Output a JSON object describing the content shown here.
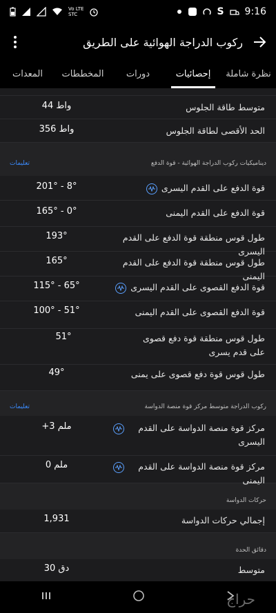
{
  "status": {
    "time": "9:16",
    "network": "STC",
    "net_type": "Vo LTE"
  },
  "appbar": {
    "title": "ركوب الدراجة الهوائية على الطريق"
  },
  "tabs": [
    {
      "label": "نظرة شاملة"
    },
    {
      "label": "إحصائيات"
    },
    {
      "label": "دورات"
    },
    {
      "label": "المخططات"
    },
    {
      "label": "المعدات"
    }
  ],
  "rows_top": [
    {
      "label": "متوسط طاقة الجلوس",
      "value": "44 واط"
    },
    {
      "label": "الحد الأقصى لطاقة الجلوس",
      "value": "356 واط"
    }
  ],
  "section_power": {
    "title": "ديناميكيات ركوب الدراجة الهوائية - قوة الدفع",
    "link": "تعليمات"
  },
  "rows_power": [
    {
      "label": "قوة الدفع على القدم اليسرى",
      "value": "201° - 8°",
      "icon": true
    },
    {
      "label": "قوة الدفع على القدم اليمنى",
      "value": "165° - 0°",
      "icon": false
    },
    {
      "label": "طول قوس منطقة قوة الدفع على القدم اليسرى",
      "value": "193°",
      "icon": false
    },
    {
      "label": "طول قوس منطقة قوة الدفع على القدم اليمنى",
      "value": "165°",
      "icon": false
    },
    {
      "label": "قوة الدفع القصوى على القدم اليسرى",
      "value": "115° - 65°",
      "icon": true
    },
    {
      "label": "قوة الدفع القصوى على القدم اليمنى",
      "value": "100° - 51°",
      "icon": false
    },
    {
      "label": "طول قوس منطقة قوة دفع قصوى على قدم يسرى",
      "value": "51°",
      "icon": false
    },
    {
      "label": "طول قوس قوة دفع قصوى على يمنى",
      "value": "49°",
      "icon": false
    }
  ],
  "section_pedal": {
    "title": "ركوب الدراجة متوسط مركز قوة منصة الدواسة",
    "link": "تعليمات"
  },
  "rows_pedal": [
    {
      "label": "مركز قوة منصة الدواسة على القدم اليسرى",
      "value": "+3 ملم",
      "icon": true
    },
    {
      "label": "مركز قوة منصة الدواسة على القدم اليمنى",
      "value": "0 ملم",
      "icon": true
    }
  ],
  "section_strokes": {
    "title": "حركات الدواسة"
  },
  "rows_strokes": [
    {
      "label": "إجمالي حركات الدواسة",
      "value": "1,931"
    }
  ],
  "section_timing": {
    "title": "دقائق الحدة"
  },
  "rows_timing": [
    {
      "label": "متوسط",
      "value": "30 دق"
    }
  ],
  "watermark": "حراج"
}
